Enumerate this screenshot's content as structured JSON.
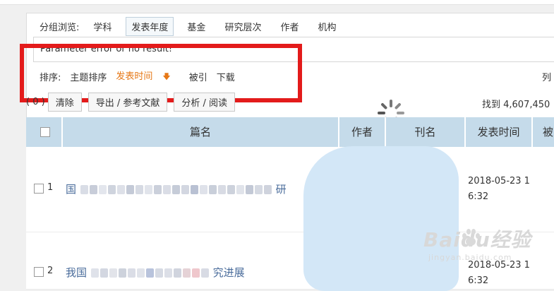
{
  "group": {
    "label": "分组浏览:",
    "tabs": [
      "学科",
      "发表年度",
      "基金",
      "研究层次",
      "作者",
      "机构"
    ],
    "active_index": 1
  },
  "message": "Parameter error or no result!",
  "sort": {
    "label": "排序:",
    "items": [
      "主题排序",
      "发表时间",
      "被引",
      "下载"
    ],
    "active_index": 1,
    "right_label": "列"
  },
  "toolbar": {
    "selected_count": "( 0 )",
    "clear": "清除",
    "export": "导出 / 参考文献",
    "analyze": "分析 / 阅读",
    "found_text": "找到 4,607,450"
  },
  "table": {
    "columns": [
      "篇名",
      "作者",
      "刊名",
      "发表时间",
      "被"
    ],
    "rows": [
      {
        "num": "1",
        "title_start": "国",
        "title_end": "研",
        "date": "2018-05-23 16:32"
      },
      {
        "num": "2",
        "title_start": "我国",
        "title_end": "究进展",
        "date": "2018-05-23 16:32"
      }
    ]
  },
  "watermark": {
    "main": "Baidu经验",
    "sub": "jingyan.baidu.com"
  },
  "colors": {
    "accent": "#e67817",
    "annotation": "#e31b1b",
    "header": "#c5dbea"
  }
}
